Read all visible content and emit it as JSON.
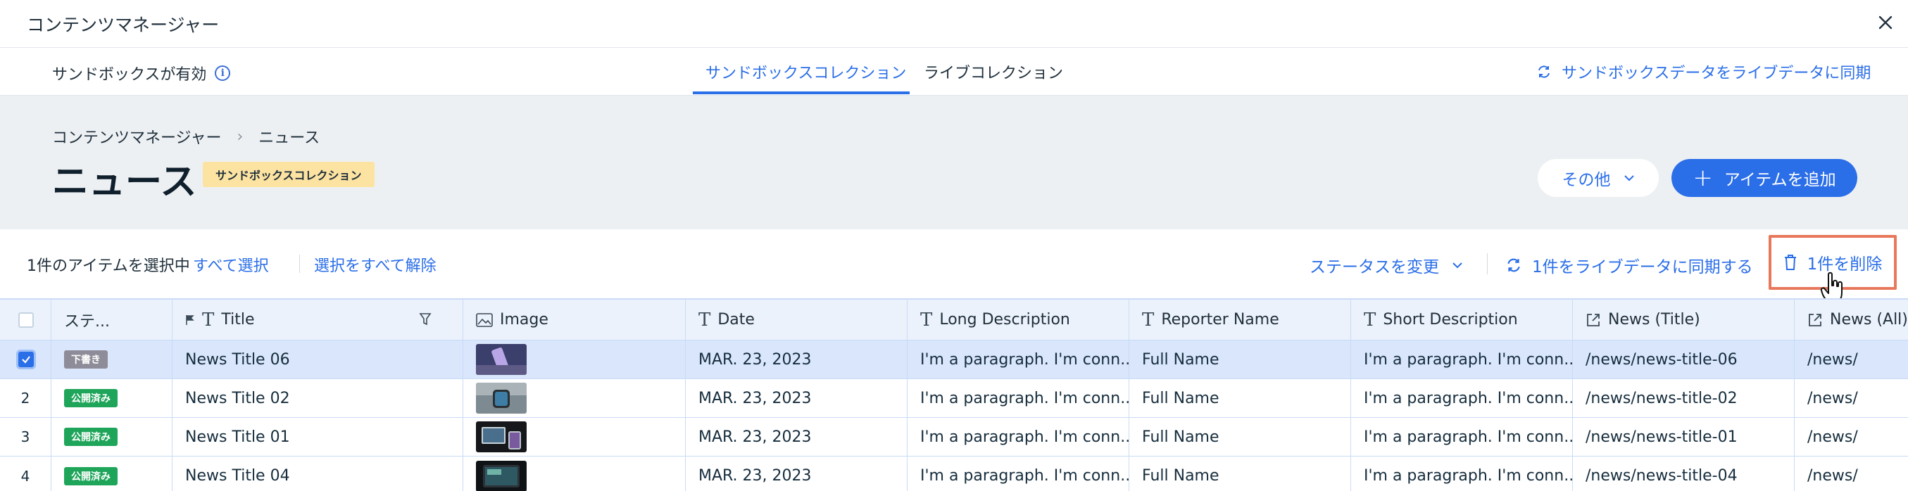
{
  "window": {
    "title": "コンテンツマネージャー"
  },
  "tabbar": {
    "sandbox_status": "サンドボックスが有効",
    "tabs": [
      {
        "label": "サンドボックスコレクション",
        "active": true
      },
      {
        "label": "ライブコレクション",
        "active": false
      }
    ],
    "sync_link": "サンドボックスデータをライブデータに同期"
  },
  "header": {
    "breadcrumb": [
      "コンテンツマネージャー",
      "ニュース"
    ],
    "title": "ニュース",
    "badge": "サンドボックスコレクション",
    "more_button": "その他",
    "add_button": "アイテムを追加"
  },
  "selection_toolbar": {
    "count_text": "1件のアイテムを選択中",
    "select_all": "すべて選択",
    "clear_all": "選択をすべて解除",
    "change_status": "ステータスを変更",
    "sync_one": "1件をライブデータに同期する",
    "delete_one": "1件を削除"
  },
  "table": {
    "columns": [
      {
        "label": "ステ..."
      },
      {
        "label": "Title",
        "icon": "text-icon"
      },
      {
        "label": "Image",
        "icon": "image-icon"
      },
      {
        "label": "Date",
        "icon": "text-icon"
      },
      {
        "label": "Long Description",
        "icon": "text-icon"
      },
      {
        "label": "Reporter Name",
        "icon": "text-icon"
      },
      {
        "label": "Short Description",
        "icon": "text-icon"
      },
      {
        "label": "News (Title)",
        "icon": "link-icon"
      },
      {
        "label": "News (All)",
        "icon": "link-icon"
      }
    ],
    "rows": [
      {
        "num": "",
        "checked": true,
        "status": "下書き",
        "status_type": "draft",
        "title": "News Title 06",
        "image": "phone-image",
        "date": "MAR. 23, 2023",
        "long_desc": "I'm a paragraph. I'm conn...",
        "reporter": "Full Name",
        "short_desc": "I'm a paragraph. I'm conn...",
        "news_title": "/news/news-title-06",
        "news_all": "/news/"
      },
      {
        "num": "2",
        "checked": false,
        "status": "公開済み",
        "status_type": "published",
        "title": "News Title 02",
        "image": "watch-image",
        "date": "MAR. 23, 2023",
        "long_desc": "I'm a paragraph. I'm conn...",
        "reporter": "Full Name",
        "short_desc": "I'm a paragraph. I'm conn...",
        "news_title": "/news/news-title-02",
        "news_all": "/news/"
      },
      {
        "num": "3",
        "checked": false,
        "status": "公開済み",
        "status_type": "published",
        "title": "News Title 01",
        "image": "devices-image",
        "date": "MAR. 23, 2023",
        "long_desc": "I'm a paragraph. I'm conn...",
        "reporter": "Full Name",
        "short_desc": "I'm a paragraph. I'm conn...",
        "news_title": "/news/news-title-01",
        "news_all": "/news/"
      },
      {
        "num": "4",
        "checked": false,
        "status": "公開済み",
        "status_type": "published",
        "title": "News Title 04",
        "image": "tablet-image",
        "date": "MAR. 23, 2023",
        "long_desc": "I'm a paragraph. I'm conn...",
        "reporter": "Full Name",
        "short_desc": "I'm a paragraph. I'm conn...",
        "news_title": "/news/news-title-04",
        "news_all": "/news/"
      }
    ]
  },
  "colors": {
    "accent": "#2a6ee8",
    "draft": "#8e8c98",
    "published": "#1fa55a",
    "highlight": "#e8785c",
    "badge": "#fde3a1"
  }
}
